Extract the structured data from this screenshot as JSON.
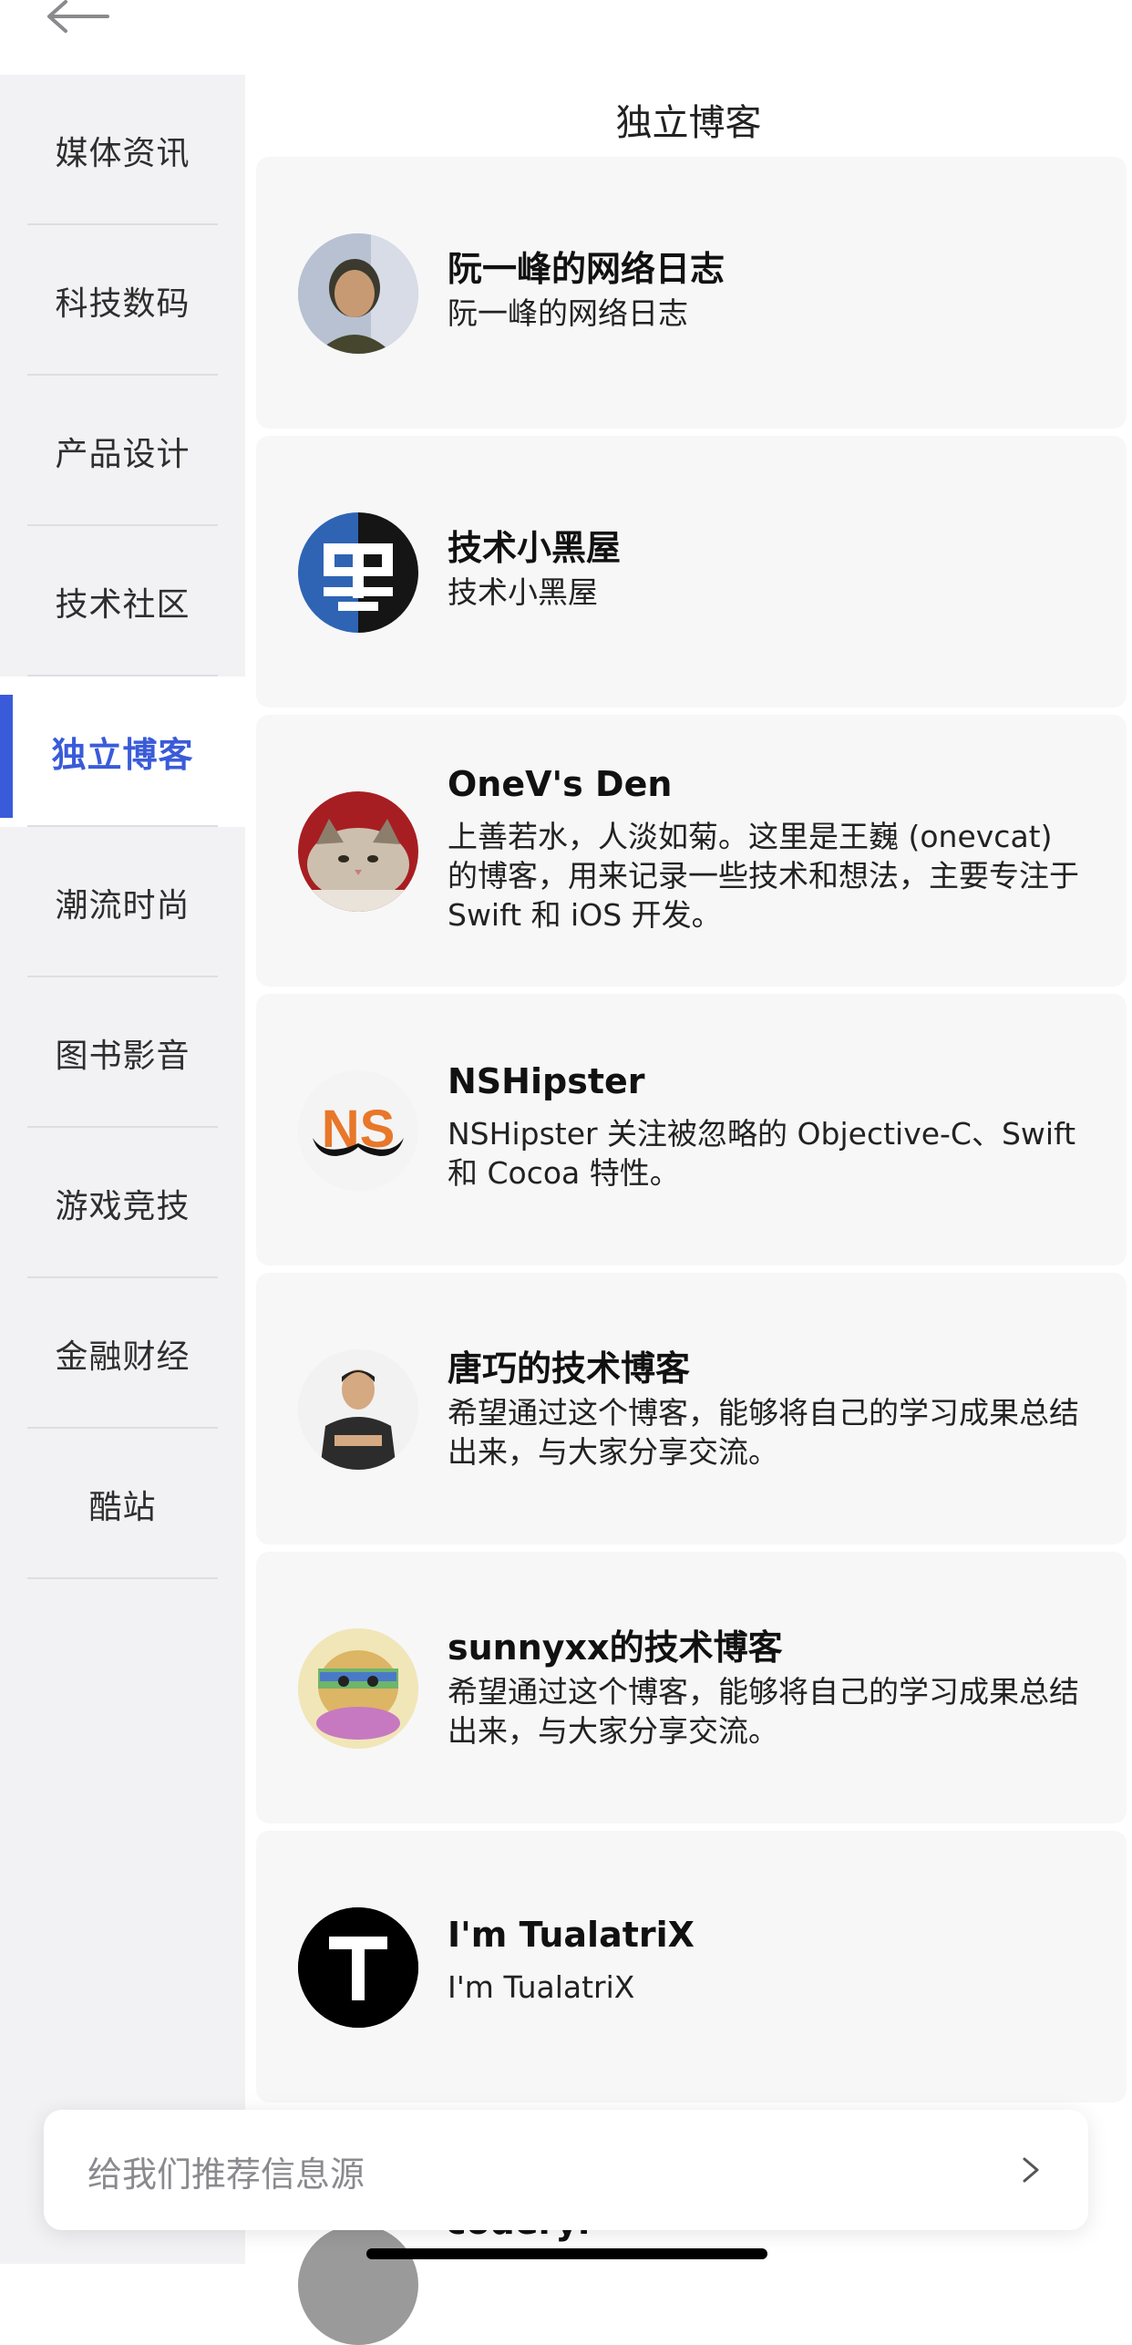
{
  "header": {
    "back_icon": "arrow-left-icon"
  },
  "sidebar": {
    "items": [
      {
        "label": "媒体资讯"
      },
      {
        "label": "科技数码"
      },
      {
        "label": "产品设计"
      },
      {
        "label": "技术社区"
      },
      {
        "label": "独立博客",
        "active": true
      },
      {
        "label": "潮流时尚"
      },
      {
        "label": "图书影音"
      },
      {
        "label": "游戏竞技"
      },
      {
        "label": "金融财经"
      },
      {
        "label": "酷站"
      }
    ],
    "active_color": "#3a5bd9"
  },
  "main": {
    "title": "独立博客",
    "cards": [
      {
        "title": "阮一峰的网络日志",
        "desc": "阮一峰的网络日志",
        "avatar": "person-photo-avatar"
      },
      {
        "title": "技术小黑屋",
        "desc": "技术小黑屋",
        "avatar": "qr-logo-avatar"
      },
      {
        "title": "OneV's Den",
        "desc": "上善若水，人淡如菊。这里是王巍 (onevcat) 的博客，用来记录一些技术和想法，主要专注于 Swift 和 iOS 开发。",
        "avatar": "cat-avatar"
      },
      {
        "title": "NSHipster",
        "desc": "NSHipster 关注被忽略的 Objective-C、Swift 和 Cocoa 特性。",
        "avatar": "mustache-logo-avatar"
      },
      {
        "title": "唐巧的技术博客",
        "desc": "希望通过这个博客，能够将自己的学习成果总结出来，与大家分享交流。",
        "avatar": "person-photo-avatar"
      },
      {
        "title": "sunnyxx的技术博客",
        "desc": "希望通过这个博客，能够将自己的学习成果总结出来，与大家分享交流。",
        "avatar": "doge-avatar"
      },
      {
        "title": "I'm TualatriX",
        "desc": "I'm TualatriX",
        "avatar": "letter-t-avatar"
      }
    ],
    "peek_title": "coderyi"
  },
  "suggest": {
    "text": "给我们推荐信息源",
    "icon": "chevron-right-icon"
  }
}
